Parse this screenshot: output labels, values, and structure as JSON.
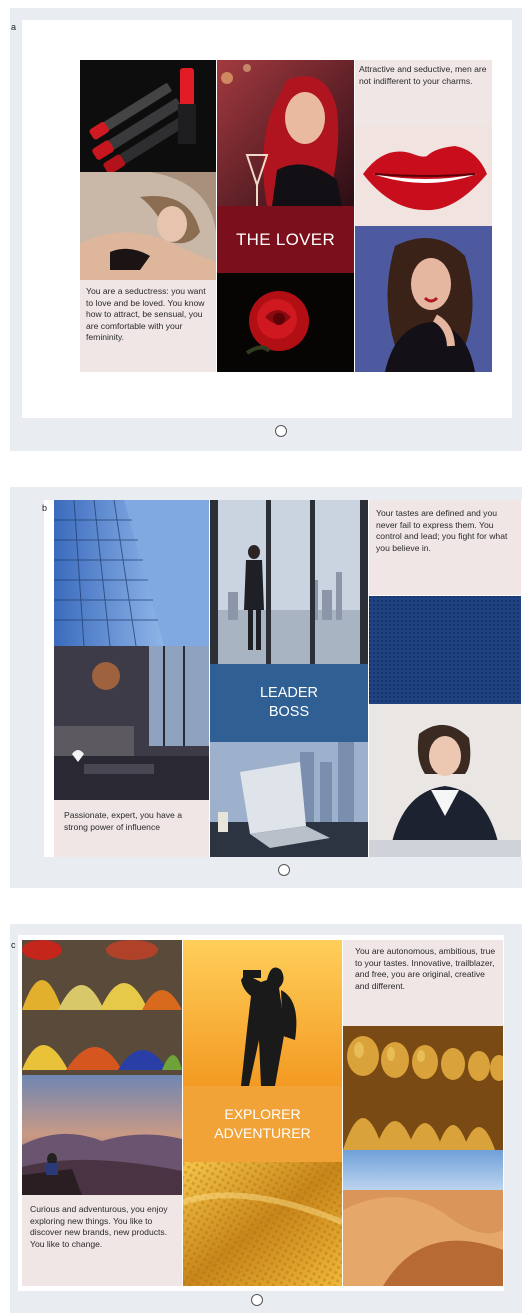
{
  "options": [
    {
      "letter": "a",
      "title": "THE LOVER",
      "top_text": "Attractive and seductive, men are not indifferent to your charms.",
      "bottom_text": "You are a seductress: you want to love and be loved. You know how to attract, be sensual, you are comfortable with your femininity."
    },
    {
      "letter": "b",
      "title_line1": "LEADER",
      "title_line2": "BOSS",
      "top_text": "Your tastes are defined and you never fail to express them. You control and lead; you fight for what you believe in.",
      "bottom_text": "Passionate, expert, you have a strong power of influence"
    },
    {
      "letter": "c",
      "title_line1": "EXPLORER",
      "title_line2": "ADVENTURER",
      "top_text": "You are autonomous, ambitious, true to your tastes. Innovative, trailblazer, and free, you are original, creative and different.",
      "bottom_text": "Curious and adventurous, you enjoy exploring new things. You like to discover new brands, new products. You like to change."
    }
  ],
  "colors": {
    "card_bg": "#e9edf1",
    "lover_title_bg": "#7b0f1c",
    "leader_title_bg": "#2f5f93",
    "explorer_title_bg": "#f2a338"
  }
}
